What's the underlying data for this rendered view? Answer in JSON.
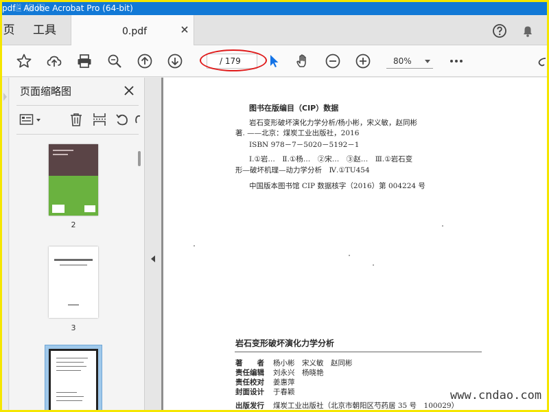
{
  "window": {
    "title": "pdf - Adobe Acrobat Pro (64-bit)",
    "watermark": "道格网"
  },
  "tabs": {
    "home_label": "页",
    "tools_label": "工具",
    "doc_label": "0.pdf"
  },
  "toolbar": {
    "page_current": "",
    "page_total": "/ 179",
    "zoom": "80%"
  },
  "icons": {
    "star": "star-icon",
    "upload": "cloud-upload-icon",
    "print": "printer-icon",
    "search": "zoom-search-icon",
    "prev": "arrow-up-icon",
    "next": "arrow-down-icon",
    "select": "cursor-arrow-icon",
    "hand": "hand-icon",
    "zoom_out": "zoom-out-icon",
    "zoom_in": "zoom-in-icon",
    "more": "more-icon"
  },
  "thumbnails": {
    "title": "页面缩略图",
    "pages": [
      {
        "label": "2"
      },
      {
        "label": "3"
      }
    ]
  },
  "document": {
    "cip_heading": "图书在版编目（CIP）数据",
    "cip_lines": [
      "岩石变形破坏演化力学分析/杨小彬，宋义敏，赵同彬",
      "著. ——北京：煤炭工业出版社，2016",
      "ISBN 978－7－5020－5192－1",
      "Ⅰ.①岩…　Ⅱ.①杨…　②宋…　③赵…　Ⅲ.①岩石变",
      "形—破坏机理—动力学分析　Ⅳ.①TU454",
      "中国版本图书馆 CIP 数据核字（2016）第 004224 号"
    ],
    "book_title": "岩石变形破坏演化力学分析",
    "info": [
      {
        "key": "著　　者",
        "value": "杨小彬　宋义敏　赵同彬"
      },
      {
        "key": "责任编辑",
        "value": "刘永兴　杨晓艳"
      },
      {
        "key": "责任校对",
        "value": "姜惠萍"
      },
      {
        "key": "封面设计",
        "value": "于春颖"
      },
      {
        "key": "出版发行",
        "value": "煤炭工业出版社（北京市朝阳区芍药居 35 号　100029）"
      }
    ]
  },
  "watermark_site": "www.cndao.com",
  "colors": {
    "titlebar": "#1279d6",
    "select_tool": "#1473e6",
    "annotation": "#e01b1b",
    "frame": "#f5e600"
  }
}
